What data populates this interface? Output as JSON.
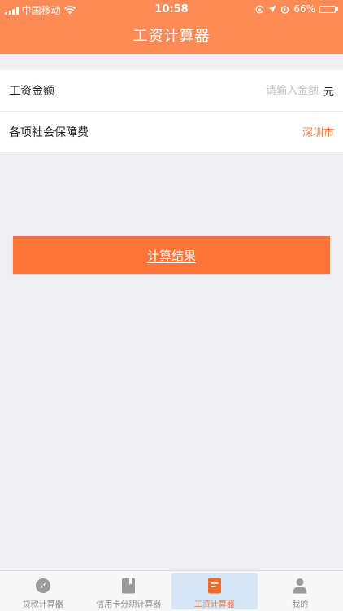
{
  "status_bar": {
    "carrier": "中国移动",
    "time": "10:58",
    "battery": "66%",
    "battery_level": 0.66
  },
  "header": {
    "title": "工资计算器"
  },
  "form": {
    "salary": {
      "label": "工资金额",
      "placeholder": "请输入金额",
      "value": "",
      "unit": "元"
    },
    "social": {
      "label": "各项社会保障费",
      "city": "深圳市"
    }
  },
  "calculate_label": "计算结果",
  "tabs": [
    {
      "label": "贷款计算器",
      "icon": "compass-icon",
      "active": false
    },
    {
      "label": "信用卡分期计算器",
      "icon": "bookmark-icon",
      "active": false
    },
    {
      "label": "工资计算器",
      "icon": "document-icon",
      "active": true
    },
    {
      "label": "我的",
      "icon": "person-icon",
      "active": false
    }
  ],
  "colors": {
    "accent": "#fe8a55",
    "button": "#ff7336",
    "link": "#f07a45",
    "background": "#efeef3"
  }
}
